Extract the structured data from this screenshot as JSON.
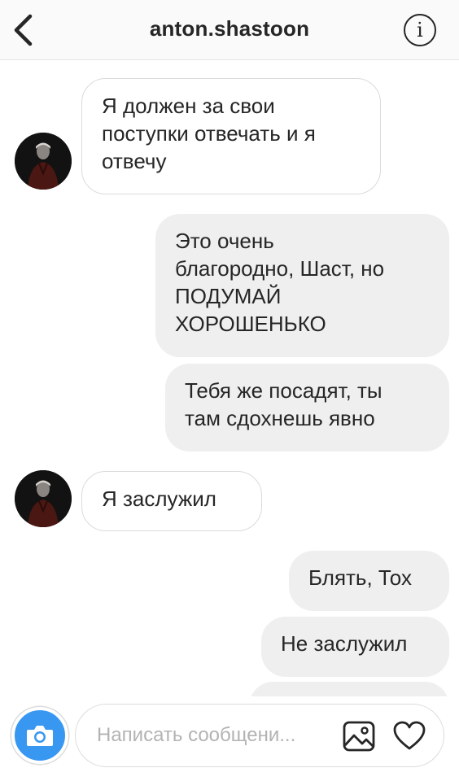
{
  "header": {
    "title": "anton.shastoon",
    "back_icon": "chevron-left-icon",
    "info_icon": "info-icon",
    "info_glyph": "i"
  },
  "messages": [
    {
      "direction": "incoming",
      "text": "Я должен за свои\nпоступки отвечать и я\nотвечу",
      "has_avatar": true
    },
    {
      "direction": "outgoing",
      "text": "Это очень\nблагородно, Шаст, но\nПОДУМАЙ\nХОРОШЕНЬКО",
      "has_avatar": false
    },
    {
      "direction": "outgoing",
      "text": "Тебя же посадят, ты\nтам сдохнешь явно",
      "has_avatar": false
    },
    {
      "direction": "incoming",
      "text": "Я заслужил",
      "has_avatar": true
    },
    {
      "direction": "outgoing",
      "text": "Блять, Тох",
      "has_avatar": false
    },
    {
      "direction": "outgoing",
      "text": "Не заслужил",
      "has_avatar": false
    },
    {
      "direction": "outgoing",
      "text": "",
      "has_avatar": false
    }
  ],
  "composer": {
    "placeholder": "Написать сообщени...",
    "camera_icon": "camera-icon",
    "gallery_icon": "image-gallery-icon",
    "heart_icon": "heart-icon"
  },
  "colors": {
    "accent": "#3897f0",
    "outgoing_bubble": "#efefef",
    "incoming_border": "#dbdbdb",
    "text": "#262626",
    "placeholder": "#b3b3b3"
  }
}
